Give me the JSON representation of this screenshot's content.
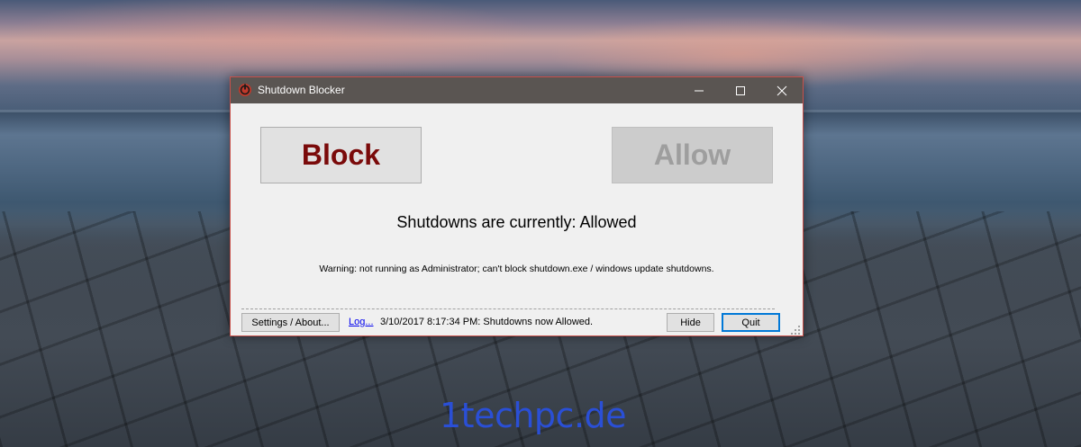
{
  "window": {
    "title": "Shutdown Blocker",
    "controls": {
      "minimize_icon": "minimize-icon",
      "maximize_icon": "maximize-icon",
      "close_icon": "close-icon"
    }
  },
  "main": {
    "block_label": "Block",
    "allow_label": "Allow",
    "status": "Shutdowns are currently: Allowed",
    "warning": "Warning: not running as Administrator; can't block shutdown.exe / windows update shutdowns."
  },
  "footer": {
    "settings_label": "Settings / About...",
    "log_link": "Log...",
    "log_message": "3/10/2017 8:17:34 PM: Shutdowns now Allowed.",
    "hide_label": "Hide",
    "quit_label": "Quit"
  },
  "watermark": "1techpc.de",
  "colors": {
    "block_text": "#7a0a0a",
    "allow_text_disabled": "#9e9e9e",
    "titlebar": "#5a5552",
    "window_border": "#c8504a",
    "link": "#0000ee",
    "focus": "#0078d7"
  }
}
